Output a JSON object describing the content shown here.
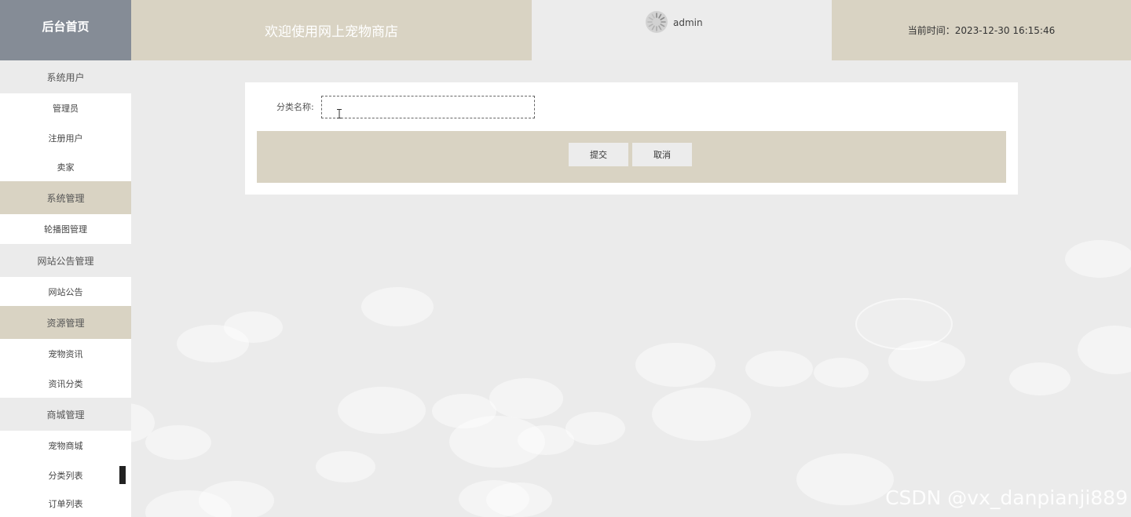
{
  "header": {
    "home_label": "后台首页",
    "welcome_text": "欢迎使用网上宠物商店",
    "username": "admin",
    "time_label": "当前时间：2023-12-30 16:15:46"
  },
  "sidebar": {
    "items": [
      {
        "label": "系统用户",
        "kind": "group"
      },
      {
        "label": "管理员",
        "kind": "item"
      },
      {
        "label": "注册用户",
        "kind": "item"
      },
      {
        "label": "卖家",
        "kind": "item"
      },
      {
        "label": "系统管理",
        "kind": "group"
      },
      {
        "label": "轮播图管理",
        "kind": "item"
      },
      {
        "label": "网站公告管理",
        "kind": "group"
      },
      {
        "label": "网站公告",
        "kind": "item"
      },
      {
        "label": "资源管理",
        "kind": "group"
      },
      {
        "label": "宠物资讯",
        "kind": "item"
      },
      {
        "label": "资讯分类",
        "kind": "item"
      },
      {
        "label": "商城管理",
        "kind": "group"
      },
      {
        "label": "宠物商城",
        "kind": "item"
      },
      {
        "label": "分类列表",
        "kind": "item"
      },
      {
        "label": "订单列表",
        "kind": "item"
      }
    ]
  },
  "form": {
    "category_name_label": "分类名称:",
    "category_name_value": "",
    "category_name_placeholder": "",
    "submit_label": "提交",
    "cancel_label": "取消"
  },
  "watermark": "CSDN @vx_danpianji889",
  "colors": {
    "beige": "#d9d3c3",
    "slate": "#858c96",
    "light_gray": "#ebebeb"
  }
}
